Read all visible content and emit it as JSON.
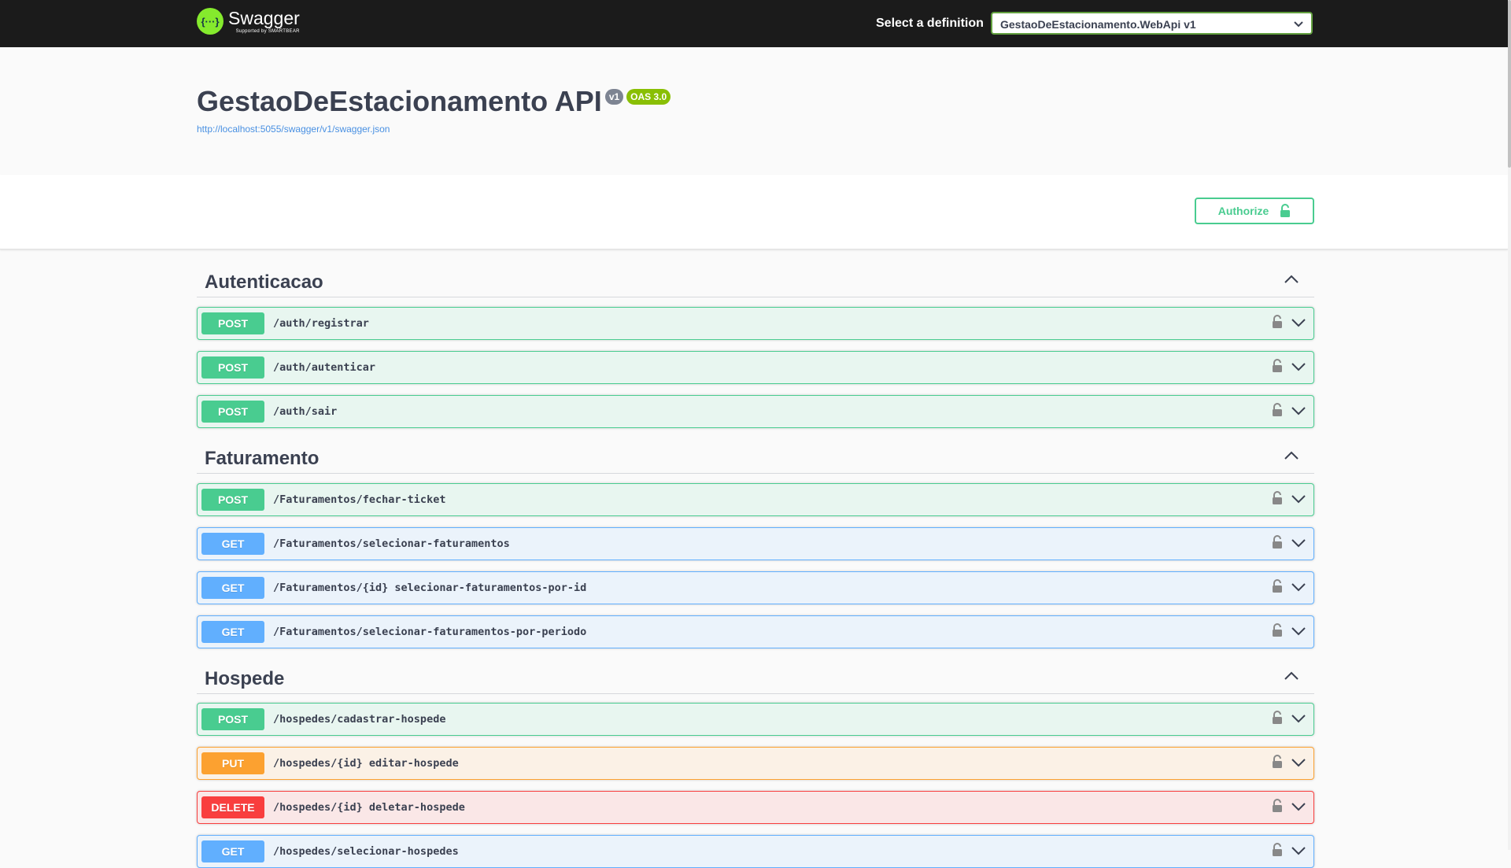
{
  "topbar": {
    "logo_icon_text": "{···}",
    "logo_name": "Swagger",
    "logo_sub": "Supported by SMARTBEAR",
    "select_label": "Select a definition",
    "selected_definition": "GestaoDeEstacionamento.WebApi v1"
  },
  "info": {
    "title": "GestaoDeEstacionamento API",
    "version": "v1",
    "oas": "OAS 3.0",
    "spec_url": "http://localhost:5055/swagger/v1/swagger.json"
  },
  "authorize_label": "Authorize",
  "sections": [
    {
      "name": "Autenticacao",
      "operations": [
        {
          "method": "POST",
          "path": "/auth/registrar"
        },
        {
          "method": "POST",
          "path": "/auth/autenticar"
        },
        {
          "method": "POST",
          "path": "/auth/sair"
        }
      ]
    },
    {
      "name": "Faturamento",
      "operations": [
        {
          "method": "POST",
          "path": "/Faturamentos/fechar-ticket"
        },
        {
          "method": "GET",
          "path": "/Faturamentos/selecionar-faturamentos"
        },
        {
          "method": "GET",
          "path": "/Faturamentos/{id} selecionar-faturamentos-por-id"
        },
        {
          "method": "GET",
          "path": "/Faturamentos/selecionar-faturamentos-por-periodo"
        }
      ]
    },
    {
      "name": "Hospede",
      "operations": [
        {
          "method": "POST",
          "path": "/hospedes/cadastrar-hospede"
        },
        {
          "method": "PUT",
          "path": "/hospedes/{id} editar-hospede"
        },
        {
          "method": "DELETE",
          "path": "/hospedes/{id} deletar-hospede"
        },
        {
          "method": "GET",
          "path": "/hospedes/selecionar-hospedes"
        }
      ]
    }
  ],
  "colors": {
    "post": "#49cc90",
    "get": "#61affe",
    "put": "#fca130",
    "delete": "#f93e3e",
    "topbar": "#1b1b1b",
    "swagger_green": "#85ea2d"
  }
}
